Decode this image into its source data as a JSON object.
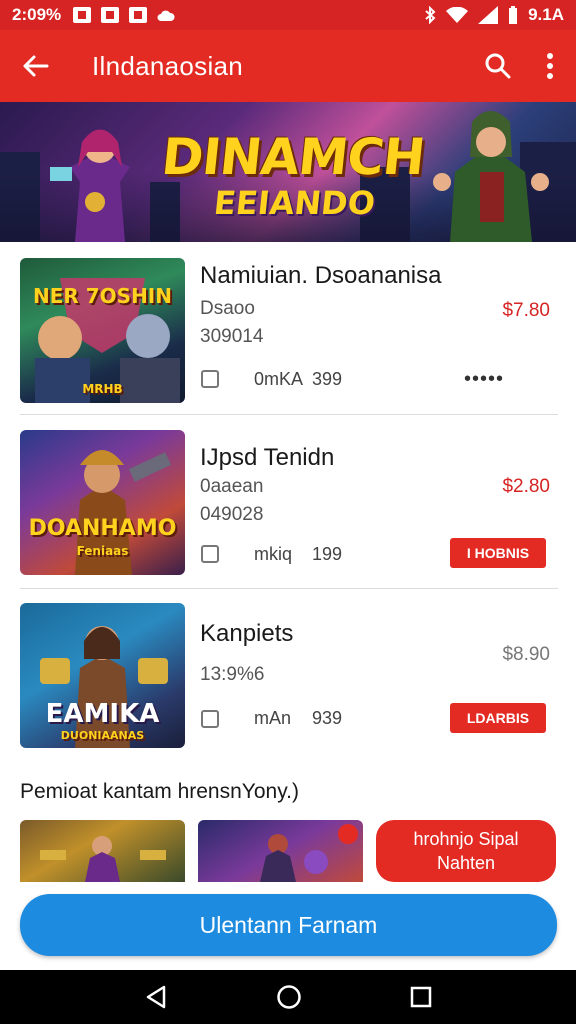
{
  "status_bar": {
    "time": "2:09%",
    "battery": "9.1A"
  },
  "app_bar": {
    "title": "Ilndanaosian"
  },
  "banner": {
    "logo_main": "DINAMCH",
    "logo_sub": "EEIANDO"
  },
  "items": [
    {
      "thumb_title": "NER 7OSHIN",
      "thumb_sub": "MRHB",
      "name": "Namiuian. Dsoananisa",
      "line1": "Dsaoo",
      "line2": "309014",
      "price": "$7.80",
      "meta": "0mKA",
      "meta2": "399",
      "dots": "•••••"
    },
    {
      "thumb_title": "DOANHAMO",
      "thumb_sub": "Feniaas",
      "name": "IJpsd Tenidn",
      "line1": "0aaean",
      "line2": "049028",
      "price": "$2.80",
      "meta": "mkiq",
      "meta2": "199",
      "badge": "I HOBNIS"
    },
    {
      "thumb_title": "EAMIKA",
      "thumb_sub": "DUONIAANAS",
      "name": "Kanpiets",
      "line1": "13:9%6",
      "price": "$8.90",
      "meta": "mAn",
      "meta2": "939",
      "badge": "LDARBIS"
    }
  ],
  "section": {
    "title": "Pemioat kantam hrensnYony.)"
  },
  "promo": {
    "line1": "hrohnjo Sipal",
    "line2": "Nahten"
  },
  "cta": {
    "label": "Ulentann Farnam"
  },
  "colors": {
    "primary": "#e32b24",
    "status": "#d62424",
    "accent": "#1c8be0",
    "price": "#d62424"
  },
  "icons": {
    "back": "arrow-left-icon",
    "search": "search-icon",
    "more": "more-vert-icon",
    "nav_back": "triangle-back-icon",
    "nav_home": "circle-home-icon",
    "nav_recent": "square-recent-icon"
  }
}
